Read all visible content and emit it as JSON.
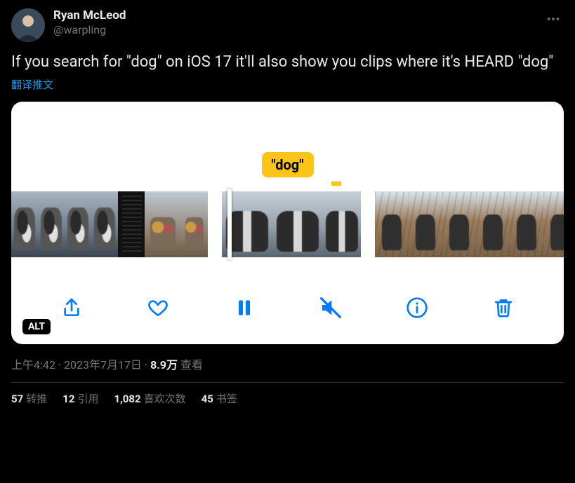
{
  "author": {
    "display_name": "Ryan McLeod",
    "handle": "@warpling"
  },
  "tweet_text": "If you search for \"dog\" on iOS 17 it'll also show you clips where it's HEARD \"dog\"",
  "translate_label": "翻译推文",
  "media": {
    "caption_text": "\"dog\"",
    "alt_badge": "ALT",
    "toolbar_icons": [
      "share",
      "heart",
      "pause",
      "mute",
      "info",
      "trash"
    ]
  },
  "meta": {
    "time": "上午4:42",
    "date": "2023年7月17日",
    "views_count": "8.9万",
    "views_label": "查看",
    "separator": " · "
  },
  "stats": {
    "retweets": {
      "count": "57",
      "label": "转推"
    },
    "quotes": {
      "count": "12",
      "label": "引用"
    },
    "likes": {
      "count": "1,082",
      "label": "喜欢次数"
    },
    "bookmarks": {
      "count": "45",
      "label": "书签"
    }
  }
}
